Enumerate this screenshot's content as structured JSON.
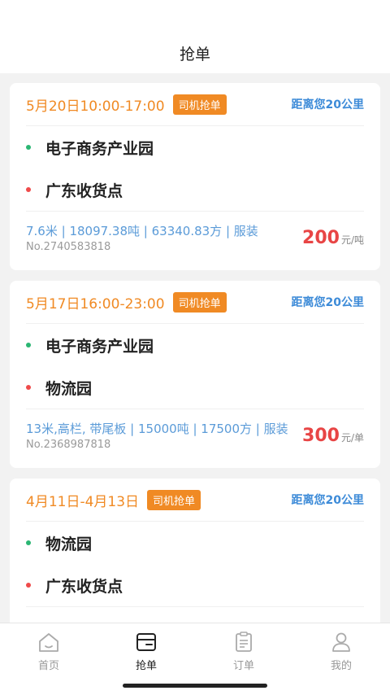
{
  "header": {
    "title": "抢单"
  },
  "orders": [
    {
      "date": "5月20日10:00-17:00",
      "tag": "司机抢单",
      "distance": "距离您20公里",
      "from": "电子商务产业园",
      "to": "广东收货点",
      "spec": "7.6米 | 18097.38吨 | 63340.83方 | 服装",
      "number": "No.2740583818",
      "price": "200",
      "price_unit": "元/吨"
    },
    {
      "date": "5月17日16:00-23:00",
      "tag": "司机抢单",
      "distance": "距离您20公里",
      "from": "电子商务产业园",
      "to": "物流园",
      "spec": "13米,高栏, 带尾板 | 15000吨 | 17500方 | 服装",
      "number": "No.2368987818",
      "price": "300",
      "price_unit": "元/单"
    },
    {
      "date": "4月11日-4月13日",
      "tag": "司机抢单",
      "distance": "距离您20公里",
      "from": "物流园",
      "to": "广东收货点"
    }
  ],
  "tabbar": {
    "items": [
      {
        "label": "首页",
        "icon": "home-icon"
      },
      {
        "label": "抢单",
        "icon": "grab-order-icon",
        "active": true
      },
      {
        "label": "订单",
        "icon": "clipboard-icon"
      },
      {
        "label": "我的",
        "icon": "user-icon"
      }
    ]
  },
  "colors": {
    "accent": "#f08a24",
    "distance": "#3d8bd8",
    "price": "#e84545",
    "spec": "#5b9bd8"
  }
}
